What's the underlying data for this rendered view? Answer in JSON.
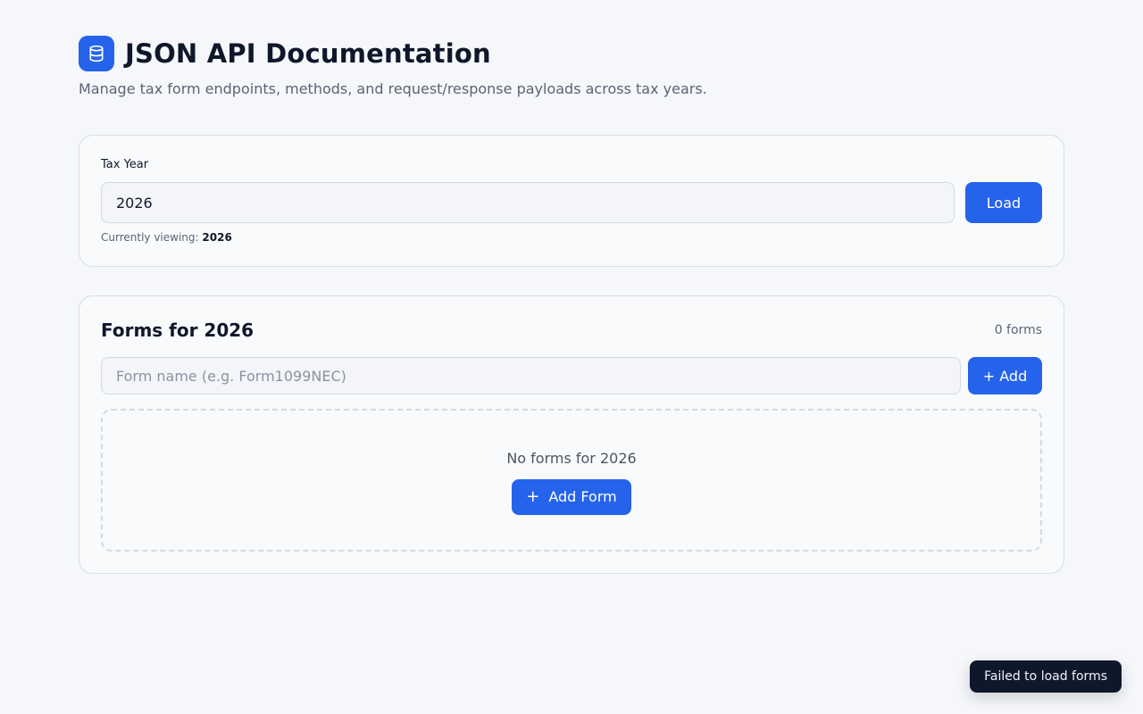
{
  "header": {
    "icon": "database-icon",
    "title": "JSON API Documentation",
    "subtitle": "Manage tax form endpoints, methods, and request/response payloads across tax years."
  },
  "tax_year": {
    "label": "Tax Year",
    "value": "2026",
    "load_label": "Load",
    "viewing_prefix": "Currently viewing:",
    "viewing_value": "2026"
  },
  "forms": {
    "title": "Forms for 2026",
    "count": "0 forms",
    "input_placeholder": "Form name (e.g. Form1099NEC)",
    "add_label": "+ Add",
    "empty_text": "No forms for 2026",
    "add_form_icon": "plus-icon",
    "add_form_label": "Add Form"
  },
  "toast": {
    "message": "Failed to load forms"
  },
  "colors": {
    "accent": "#2563eb",
    "background": "#f5f7fa",
    "toast_bg": "#0f172a"
  }
}
